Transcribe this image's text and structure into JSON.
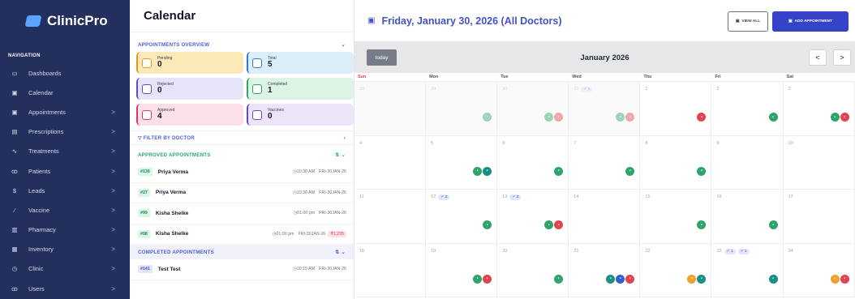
{
  "brand": {
    "name": "ClinicPro"
  },
  "nav": {
    "label": "NAVIGATION",
    "items": [
      {
        "label": "Dashboards",
        "icon": "monitor-icon",
        "chev": ""
      },
      {
        "label": "Calendar",
        "icon": "calendar-icon",
        "chev": ""
      },
      {
        "label": "Appointments",
        "icon": "calendar-icon",
        "chev": ">"
      },
      {
        "label": "Prescriptions",
        "icon": "document-icon",
        "chev": ">"
      },
      {
        "label": "Treatments",
        "icon": "activity-icon",
        "chev": ">"
      },
      {
        "label": "Patients",
        "icon": "users-icon",
        "chev": ">"
      },
      {
        "label": "Leads",
        "icon": "dollar-icon",
        "chev": ">"
      },
      {
        "label": "Vaccine",
        "icon": "syringe-icon",
        "chev": ">"
      },
      {
        "label": "Pharmacy",
        "icon": "pharmacy-icon",
        "chev": ">"
      },
      {
        "label": "Inventory",
        "icon": "box-icon",
        "chev": ">"
      },
      {
        "label": "Clinic",
        "icon": "clock-icon",
        "chev": ">"
      },
      {
        "label": "Users",
        "icon": "users-icon",
        "chev": ">"
      }
    ]
  },
  "middle": {
    "title": "Calendar",
    "overview_title": "APPOINTMENTS OVERVIEW",
    "cards": [
      {
        "label": "Pending",
        "value": "0",
        "bg": "#fbe9b8",
        "accent": "#e49a17"
      },
      {
        "label": "Total",
        "value": "5",
        "bg": "#ddeefb",
        "accent": "#2f7bd7"
      },
      {
        "label": "Rejected",
        "value": "0",
        "bg": "#e6e4f9",
        "accent": "#5b4dd1"
      },
      {
        "label": "Completed",
        "value": "1",
        "bg": "#ddf4e4",
        "accent": "#2fa36b"
      },
      {
        "label": "Approved",
        "value": "4",
        "bg": "#fbe0e8",
        "accent": "#d93a63"
      },
      {
        "label": "Vaccines",
        "value": "0",
        "bg": "#ece4f7",
        "accent": "#6b46c1"
      }
    ],
    "filter_label": "FILTER BY DOCTOR",
    "approved_title": "APPROVED APPOINTMENTS",
    "approved": [
      {
        "id": "#136",
        "name": "Priya Verma",
        "time": "10:30 AM",
        "date": "FRI-30JAN-26",
        "amount": ""
      },
      {
        "id": "#27",
        "name": "Priya Verma",
        "time": "10:30 AM",
        "date": "FRI-30JAN-26",
        "amount": ""
      },
      {
        "id": "#99",
        "name": "Kisha Shelke",
        "time": "01:00 pm",
        "date": "FRI-30JAN-26",
        "amount": ""
      },
      {
        "id": "#98",
        "name": "Kisha Shelke",
        "time": "01:00 pm",
        "date": "FRI-30JAN-26",
        "amount": "₹1,235"
      }
    ],
    "completed_title": "COMPLETED APPOINTMENTS",
    "completed": [
      {
        "id": "#141",
        "name": "Test Test",
        "time": "10:15 AM",
        "date": "FRI-30JAN-26",
        "amount": ""
      }
    ]
  },
  "calendar": {
    "header_title": "Friday, January 30, 2026  (All Doctors)",
    "view_all": "VIEW ALL",
    "add_appointment": "ADD APPOINTMENT",
    "today": "today",
    "month": "January 2026",
    "prev": "<",
    "next": ">",
    "days": [
      "Sun",
      "Mon",
      "Tue",
      "Wed",
      "Thu",
      "Fri",
      "Sat"
    ],
    "cells": [
      {
        "d": "28",
        "dim": true,
        "chips": [],
        "dots": []
      },
      {
        "d": "29",
        "dim": true,
        "chips": [],
        "dots": [
          "g"
        ]
      },
      {
        "d": "30",
        "dim": true,
        "chips": [],
        "dots": [
          "g",
          "r"
        ]
      },
      {
        "d": "31",
        "dim": true,
        "chips": [
          "✓ 1"
        ],
        "dots": [
          "g",
          "r"
        ]
      },
      {
        "d": "1",
        "dim": false,
        "chips": [],
        "dots": [
          "r"
        ]
      },
      {
        "d": "2",
        "dim": false,
        "chips": [],
        "dots": [
          "g"
        ]
      },
      {
        "d": "3",
        "dim": false,
        "chips": [],
        "dots": [
          "g",
          "r"
        ]
      },
      {
        "d": "4",
        "dim": false,
        "chips": [],
        "dots": []
      },
      {
        "d": "5",
        "dim": false,
        "chips": [],
        "dots": [
          "g",
          "t"
        ]
      },
      {
        "d": "6",
        "dim": false,
        "chips": [],
        "dots": [
          "g"
        ]
      },
      {
        "d": "7",
        "dim": false,
        "chips": [],
        "dots": [
          "g"
        ]
      },
      {
        "d": "8",
        "dim": false,
        "chips": [],
        "dots": [
          "g"
        ]
      },
      {
        "d": "9",
        "dim": false,
        "chips": [],
        "dots": []
      },
      {
        "d": "10",
        "dim": false,
        "chips": [],
        "dots": []
      },
      {
        "d": "11",
        "dim": false,
        "chips": [],
        "dots": []
      },
      {
        "d": "12",
        "dim": false,
        "chips": [
          "✓ 2"
        ],
        "dots": [
          "g"
        ]
      },
      {
        "d": "13",
        "dim": false,
        "chips": [
          "✓ 2"
        ],
        "dots": [
          "g",
          "r"
        ]
      },
      {
        "d": "14",
        "dim": false,
        "chips": [],
        "dots": []
      },
      {
        "d": "15",
        "dim": false,
        "chips": [],
        "dots": [
          "g"
        ]
      },
      {
        "d": "16",
        "dim": false,
        "chips": [],
        "dots": [
          "g"
        ]
      },
      {
        "d": "17",
        "dim": false,
        "chips": [],
        "dots": []
      },
      {
        "d": "18",
        "dim": false,
        "chips": [],
        "dots": []
      },
      {
        "d": "19",
        "dim": false,
        "chips": [],
        "dots": [
          "g",
          "r"
        ]
      },
      {
        "d": "20",
        "dim": false,
        "chips": [],
        "dots": [
          "g"
        ]
      },
      {
        "d": "21",
        "dim": false,
        "chips": [],
        "dots": [
          "t",
          "b",
          "r"
        ]
      },
      {
        "d": "22",
        "dim": false,
        "chips": [],
        "dots": [
          "o",
          "t"
        ]
      },
      {
        "d": "23",
        "dim": false,
        "chips": [
          "✓ 1",
          "✓ 1"
        ],
        "dots": [
          "t"
        ]
      },
      {
        "d": "24",
        "dim": false,
        "chips": [],
        "dots": [
          "o",
          "r"
        ]
      }
    ]
  }
}
